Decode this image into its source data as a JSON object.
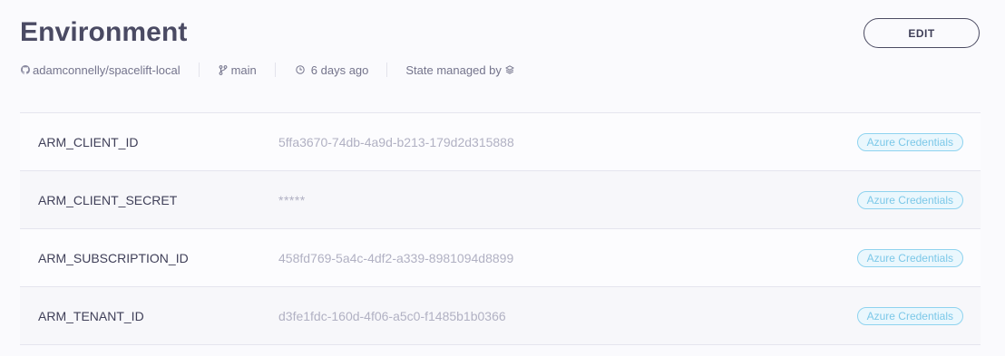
{
  "header": {
    "title": "Environment",
    "edit_label": "EDIT"
  },
  "meta": {
    "repo": "adamconnelly/spacelift-local",
    "branch": "main",
    "updated": "6 days ago",
    "state_label": "State managed by"
  },
  "icons": {
    "repo": "github-icon",
    "branch": "git-branch-icon",
    "time": "clock-icon",
    "state": "spacelift-logo-icon"
  },
  "colors": {
    "badge_border": "#8fd3ef",
    "badge_text": "#7cc8e8",
    "title": "#4a4a63"
  },
  "variables": [
    {
      "name": "ARM_CLIENT_ID",
      "value": "5ffa3670-74db-4a9d-b213-179d2d315888",
      "badge": "Azure Credentials"
    },
    {
      "name": "ARM_CLIENT_SECRET",
      "value": "*****",
      "badge": "Azure Credentials"
    },
    {
      "name": "ARM_SUBSCRIPTION_ID",
      "value": "458fd769-5a4c-4df2-a339-8981094d8899",
      "badge": "Azure Credentials"
    },
    {
      "name": "ARM_TENANT_ID",
      "value": "d3fe1fdc-160d-4f06-a5c0-f1485b1b0366",
      "badge": "Azure Credentials"
    }
  ]
}
